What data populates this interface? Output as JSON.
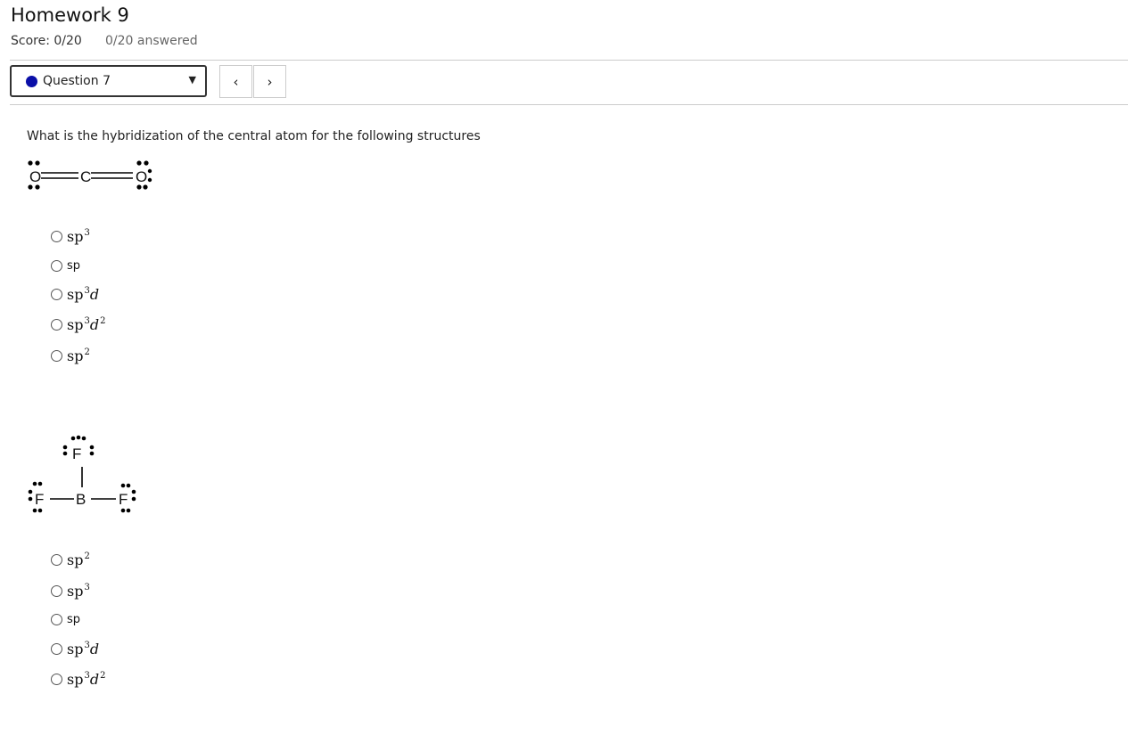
{
  "header": {
    "title": "Homework 9",
    "score": "Score: 0/20",
    "answered": "0/20 answered"
  },
  "question_nav": {
    "selected_label": "Question 7",
    "status_color": "#0a0fa8",
    "prev_label": "‹",
    "next_label": "›"
  },
  "question": {
    "prompt": "What is the hybridization of the central atom for the following structures",
    "parts": [
      {
        "structure": {
          "name": "CO2",
          "atoms": [
            "O",
            "C",
            "O"
          ]
        },
        "options": [
          {
            "base": "sp",
            "sup": "3",
            "d": "",
            "dsup": ""
          },
          {
            "base": "sp",
            "sup": "",
            "d": "",
            "dsup": ""
          },
          {
            "base": "sp",
            "sup": "3",
            "d": "d",
            "dsup": ""
          },
          {
            "base": "sp",
            "sup": "3",
            "d": "d",
            "dsup": "2"
          },
          {
            "base": "sp",
            "sup": "2",
            "d": "",
            "dsup": ""
          }
        ]
      },
      {
        "structure": {
          "name": "BF3",
          "atoms": [
            "F",
            "F",
            "B",
            "F"
          ]
        },
        "options": [
          {
            "base": "sp",
            "sup": "2",
            "d": "",
            "dsup": ""
          },
          {
            "base": "sp",
            "sup": "3",
            "d": "",
            "dsup": ""
          },
          {
            "base": "sp",
            "sup": "",
            "d": "",
            "dsup": ""
          },
          {
            "base": "sp",
            "sup": "3",
            "d": "d",
            "dsup": ""
          },
          {
            "base": "sp",
            "sup": "3",
            "d": "d",
            "dsup": "2"
          }
        ]
      }
    ]
  }
}
